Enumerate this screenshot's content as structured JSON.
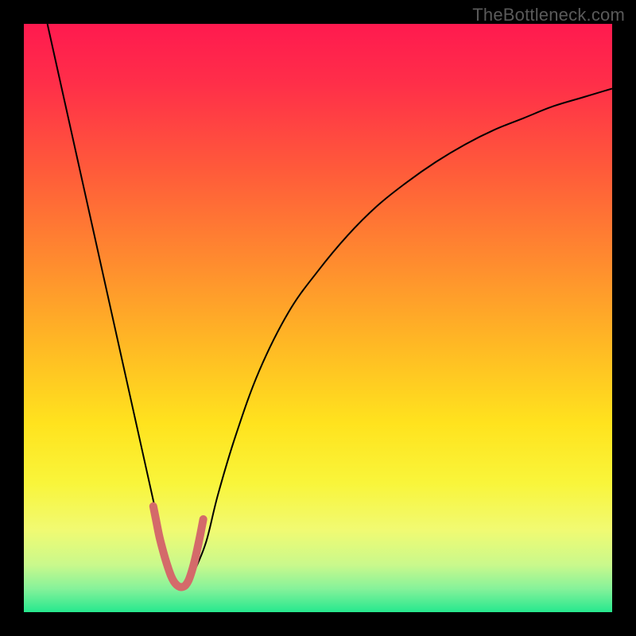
{
  "watermark": "TheBottleneck.com",
  "chart_data": {
    "type": "line",
    "title": "",
    "xlabel": "",
    "ylabel": "",
    "xlim": [
      0,
      100
    ],
    "ylim": [
      0,
      100
    ],
    "background_gradient_stops": [
      {
        "pos": 0.0,
        "color": "#ff1a4f"
      },
      {
        "pos": 0.1,
        "color": "#ff2e49"
      },
      {
        "pos": 0.25,
        "color": "#ff5b3a"
      },
      {
        "pos": 0.4,
        "color": "#ff8a2f"
      },
      {
        "pos": 0.55,
        "color": "#ffba24"
      },
      {
        "pos": 0.68,
        "color": "#ffe31e"
      },
      {
        "pos": 0.78,
        "color": "#f9f53a"
      },
      {
        "pos": 0.86,
        "color": "#f1fa72"
      },
      {
        "pos": 0.92,
        "color": "#c9f98c"
      },
      {
        "pos": 0.96,
        "color": "#86f29a"
      },
      {
        "pos": 1.0,
        "color": "#26e88e"
      }
    ],
    "series": [
      {
        "name": "bottleneck-curve",
        "color": "#000000",
        "width": 2,
        "x": [
          4,
          6,
          8,
          10,
          12,
          14,
          16,
          18,
          20,
          22,
          23,
          24,
          25,
          26,
          27,
          28,
          29,
          31,
          33,
          36,
          40,
          45,
          50,
          55,
          60,
          65,
          70,
          75,
          80,
          85,
          90,
          95,
          100
        ],
        "values": [
          100,
          91,
          82,
          73,
          64,
          55,
          46,
          37,
          28,
          19,
          14,
          10,
          7,
          5,
          4.5,
          5,
          7,
          12,
          20,
          30,
          41,
          51,
          58,
          64,
          69,
          73,
          76.5,
          79.5,
          82,
          84,
          86,
          87.5,
          89
        ]
      },
      {
        "name": "trough-highlight",
        "color": "#d46a6a",
        "width": 10,
        "linecap": "round",
        "x": [
          22.0,
          22.5,
          23.0,
          23.5,
          24.0,
          24.5,
          25.0,
          25.5,
          26.0,
          26.5,
          27.0,
          27.5,
          28.0,
          28.5,
          29.0,
          29.5,
          30.0,
          30.5
        ],
        "values": [
          18.0,
          15.5,
          13.0,
          11.0,
          9.2,
          7.6,
          6.2,
          5.2,
          4.6,
          4.3,
          4.3,
          4.6,
          5.4,
          6.8,
          8.6,
          10.8,
          13.2,
          15.8
        ]
      }
    ]
  }
}
